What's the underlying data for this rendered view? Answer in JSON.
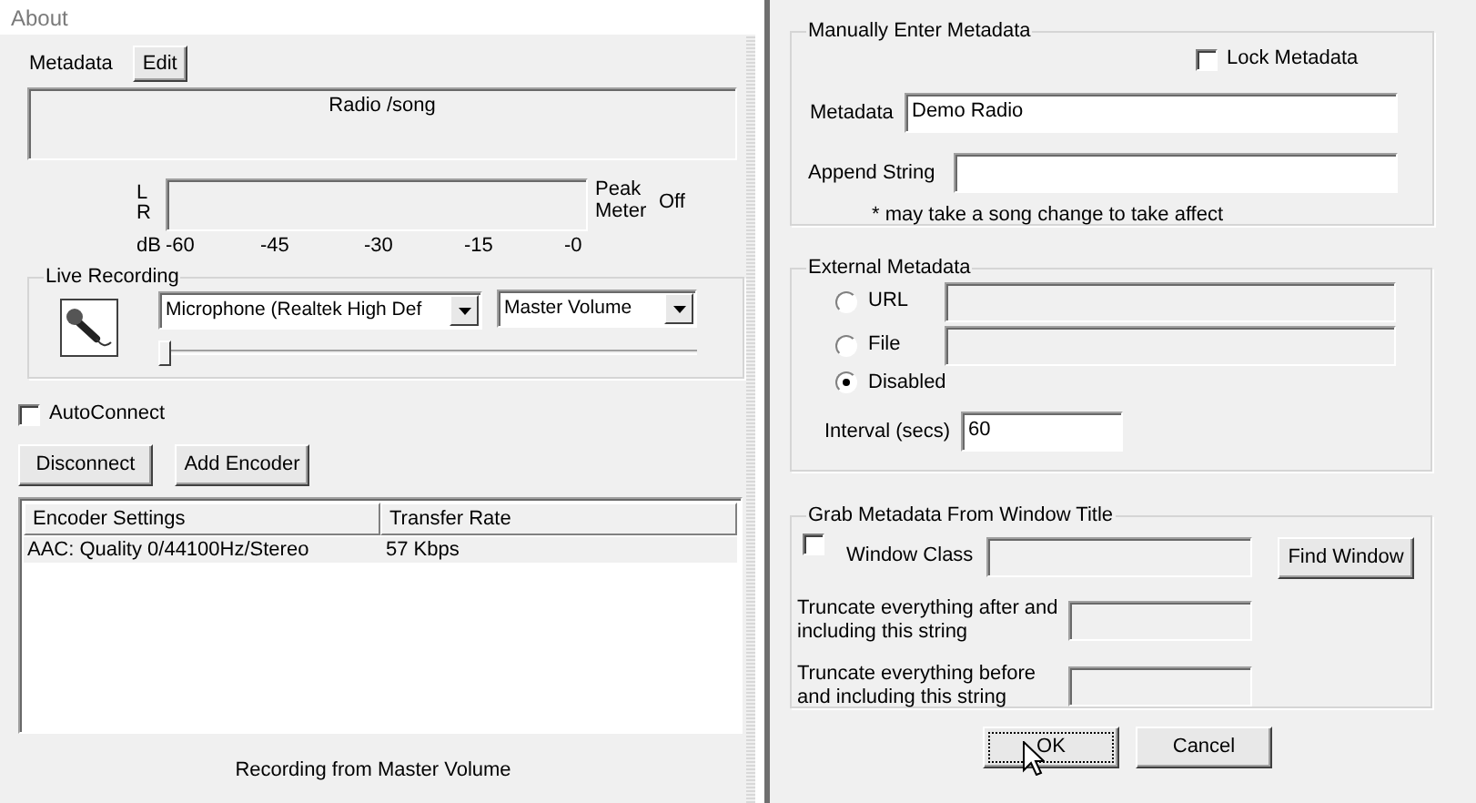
{
  "about_window": {
    "title": "About",
    "metadata": {
      "label": "Metadata",
      "edit_button": "Edit",
      "display": "Radio /song"
    },
    "peak_meter": {
      "channel_labels": [
        "L",
        "R"
      ],
      "level": 0,
      "label": "Peak Meter",
      "state": "Off",
      "scale_unit": "dB",
      "scale": [
        "-60",
        "-45",
        "-30",
        "-15",
        "-0"
      ]
    },
    "live_recording": {
      "title": "Live Recording",
      "device": "Microphone (Realtek High Def",
      "mixer": "Master Volume",
      "volume": {
        "level": 0
      }
    },
    "auto_connect": {
      "label": "AutoConnect",
      "checked": false
    },
    "buttons": [
      "Disconnect",
      "Add Encoder"
    ],
    "encoders": {
      "columns": [
        "Encoder Settings",
        "Transfer Rate"
      ],
      "rows": [
        {
          "cells": [
            "AAC: Quality 0/44100Hz/Stereo",
            "57 Kbps"
          ],
          "selected": true
        }
      ]
    },
    "status": "Recording from Master Volume"
  },
  "metadata_dialog": {
    "manual": {
      "title": "Manually Enter Metadata",
      "lock": {
        "label": "Lock Metadata",
        "checked": false
      },
      "fields": [
        {
          "label": "Metadata",
          "value": "Demo Radio"
        },
        {
          "label": "Append String"
        }
      ],
      "note": "* may take a song change to take affect"
    },
    "external": {
      "title": "External Metadata",
      "options": [
        {
          "label": "URL",
          "selected": false,
          "field": {
            "disabled": true
          }
        },
        {
          "label": "File",
          "selected": false,
          "field": {
            "disabled": true
          }
        },
        {
          "label": "Disabled",
          "selected": true
        }
      ],
      "interval": {
        "label": "Interval (secs)",
        "value": "60"
      }
    },
    "window_title": {
      "title": "Grab Metadata From Window Title",
      "enable": {
        "checked": false
      },
      "window_class": {
        "label": "Window Class",
        "disabled": true
      },
      "find_button": "Find Window",
      "truncate": [
        {
          "label": "Truncate everything after and including this string",
          "disabled": true
        },
        {
          "label": "Truncate everything before and including this string",
          "disabled": true
        }
      ]
    },
    "buttons": [
      "OK",
      "Cancel"
    ]
  }
}
